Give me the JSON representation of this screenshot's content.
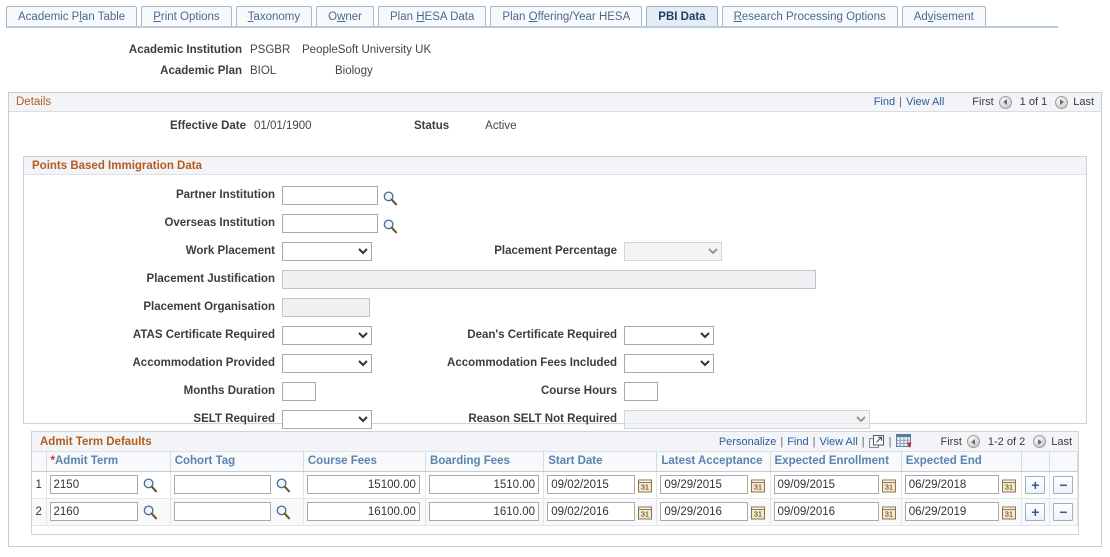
{
  "tabs": [
    {
      "label": "Academic Plan Table",
      "accel": "l",
      "active": false
    },
    {
      "label": "Print Options",
      "accel": "P",
      "active": false
    },
    {
      "label": "Taxonomy",
      "accel": "T",
      "active": false
    },
    {
      "label": "Owner",
      "accel": "w",
      "active": false
    },
    {
      "label": "Plan HESA Data",
      "accel": "H",
      "active": false
    },
    {
      "label": "Plan Offering/Year HESA",
      "accel": "O",
      "active": false
    },
    {
      "label": "PBI Data",
      "accel": "",
      "active": true
    },
    {
      "label": "Research Processing Options",
      "accel": "R",
      "active": false
    },
    {
      "label": "Advisement",
      "accel": "v",
      "active": false
    }
  ],
  "header": {
    "institution_label": "Academic Institution",
    "institution_code": "PSGBR",
    "institution_name": "PeopleSoft University UK",
    "plan_label": "Academic Plan",
    "plan_code": "BIOL",
    "plan_name": "Biology"
  },
  "details": {
    "title": "Details",
    "find_label": "Find",
    "view_all_label": "View All",
    "first_label": "First",
    "counter": "1 of 1",
    "last_label": "Last",
    "effective_date_label": "Effective Date",
    "effective_date_value": "01/01/1900",
    "status_label": "Status",
    "status_value": "Active"
  },
  "pbi": {
    "title": "Points Based Immigration Data",
    "partner_institution_label": "Partner Institution",
    "partner_institution_value": "",
    "overseas_institution_label": "Overseas Institution",
    "overseas_institution_value": "",
    "work_placement_label": "Work Placement",
    "work_placement_value": "",
    "placement_percentage_label": "Placement Percentage",
    "placement_percentage_value": "",
    "placement_justification_label": "Placement Justification",
    "placement_justification_value": "",
    "placement_organisation_label": "Placement Organisation",
    "placement_organisation_value": "",
    "atas_label": "ATAS Certificate Required",
    "atas_value": "",
    "deans_label": "Dean's Certificate Required",
    "deans_value": "",
    "accommodation_provided_label": "Accommodation Provided",
    "accommodation_provided_value": "",
    "accommodation_fees_label": "Accommodation Fees Included",
    "accommodation_fees_value": "",
    "months_duration_label": "Months Duration",
    "months_duration_value": "",
    "course_hours_label": "Course Hours",
    "course_hours_value": "",
    "selt_label": "SELT Required",
    "selt_value": "",
    "reason_selt_label": "Reason SELT Not Required",
    "reason_selt_value": ""
  },
  "grid": {
    "title": "Admit Term Defaults",
    "personalize_label": "Personalize",
    "find_label": "Find",
    "view_all_label": "View All",
    "first_label": "First",
    "counter": "1-2 of 2",
    "last_label": "Last",
    "newwindow_icon": "new-window-icon",
    "spreadsheet_icon": "download-spreadsheet-icon",
    "columns": [
      {
        "label": "Admit Term",
        "required": true
      },
      {
        "label": "Cohort Tag",
        "required": false
      },
      {
        "label": "Course Fees",
        "required": false
      },
      {
        "label": "Boarding Fees",
        "required": false
      },
      {
        "label": "Start Date",
        "required": false
      },
      {
        "label": "Latest Acceptance",
        "required": false
      },
      {
        "label": "Expected Enrollment",
        "required": false
      },
      {
        "label": "Expected End",
        "required": false
      }
    ],
    "rows": [
      {
        "num": "1",
        "admit_term": "2150",
        "cohort_tag": "",
        "course_fees": "15100.00",
        "boarding_fees": "1510.00",
        "start_date": "09/02/2015",
        "latest_acceptance": "09/29/2015",
        "expected_enrollment": "09/09/2015",
        "expected_end": "06/29/2018",
        "add_label": "+",
        "remove_label": "−"
      },
      {
        "num": "2",
        "admit_term": "2160",
        "cohort_tag": "",
        "course_fees": "16100.00",
        "boarding_fees": "1610.00",
        "start_date": "09/02/2016",
        "latest_acceptance": "09/29/2016",
        "expected_enrollment": "09/09/2016",
        "expected_end": "06/29/2019",
        "add_label": "+",
        "remove_label": "−"
      }
    ]
  },
  "colors": {
    "group_title": "#b35c1e",
    "link": "#2f5c9e",
    "column_header": "#5b83b0",
    "tab_active_bg": "#e4ecf5",
    "required_asterisk": "#cc2a2a"
  }
}
